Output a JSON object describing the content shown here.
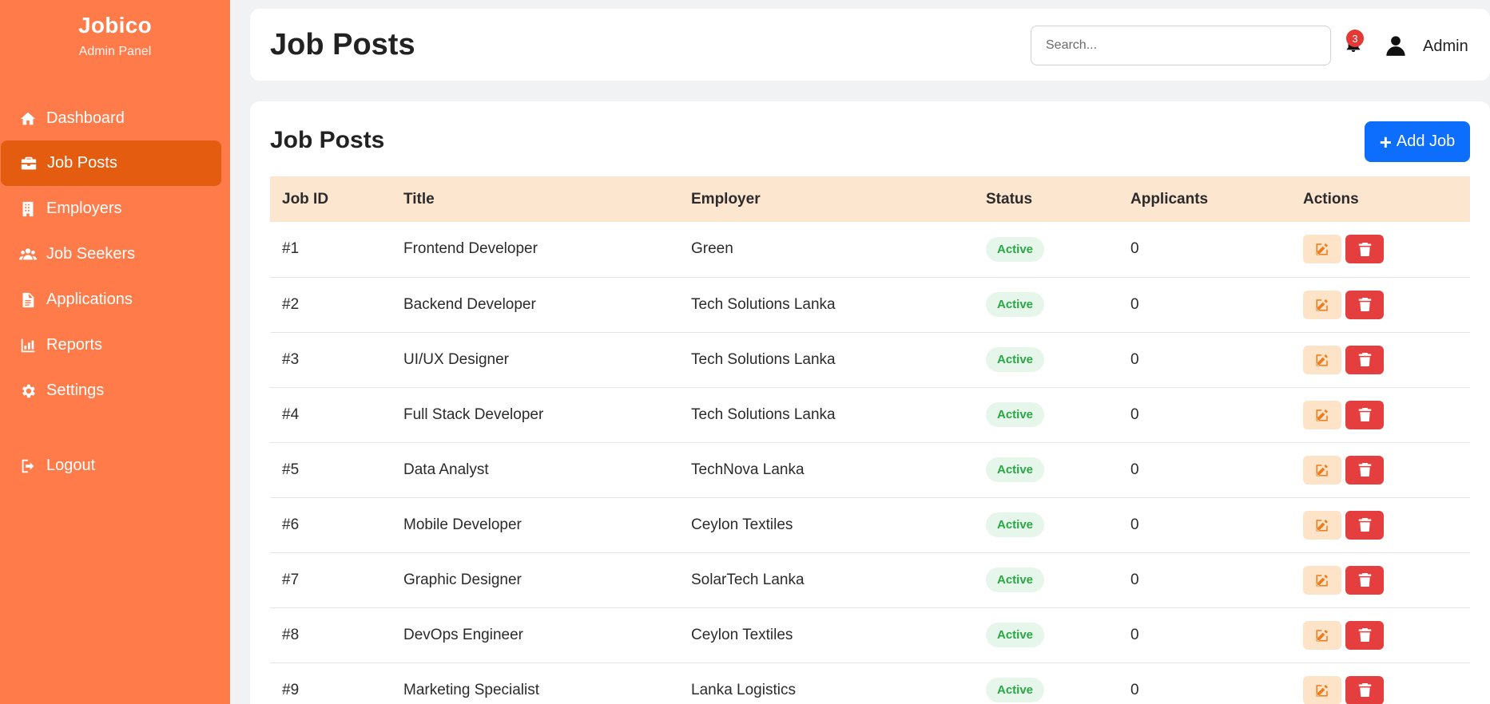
{
  "brand": {
    "name": "Jobico",
    "subtitle": "Admin Panel"
  },
  "sidebar": {
    "items": [
      {
        "label": "Dashboard",
        "icon": "home-icon",
        "active": false
      },
      {
        "label": "Job Posts",
        "icon": "briefcase-icon",
        "active": true
      },
      {
        "label": "Employers",
        "icon": "building-icon",
        "active": false
      },
      {
        "label": "Job Seekers",
        "icon": "users-icon",
        "active": false
      },
      {
        "label": "Applications",
        "icon": "file-icon",
        "active": false
      },
      {
        "label": "Reports",
        "icon": "chart-icon",
        "active": false
      },
      {
        "label": "Settings",
        "icon": "gear-icon",
        "active": false
      },
      {
        "label": "Logout",
        "icon": "logout-icon",
        "active": false
      }
    ]
  },
  "header": {
    "title": "Job Posts",
    "search_placeholder": "Search...",
    "notification_count": "3",
    "user_name": "Admin"
  },
  "main": {
    "card_title": "Job Posts",
    "add_button_label": "Add Job",
    "columns": [
      "Job ID",
      "Title",
      "Employer",
      "Status",
      "Applicants",
      "Actions"
    ],
    "rows": [
      {
        "id": "#1",
        "title": "Frontend Developer",
        "employer": "Green",
        "status": "Active",
        "applicants": "0"
      },
      {
        "id": "#2",
        "title": "Backend Developer",
        "employer": "Tech Solutions Lanka",
        "status": "Active",
        "applicants": "0"
      },
      {
        "id": "#3",
        "title": "UI/UX Designer",
        "employer": "Tech Solutions Lanka",
        "status": "Active",
        "applicants": "0"
      },
      {
        "id": "#4",
        "title": "Full Stack Developer",
        "employer": "Tech Solutions Lanka",
        "status": "Active",
        "applicants": "0"
      },
      {
        "id": "#5",
        "title": "Data Analyst",
        "employer": "TechNova Lanka",
        "status": "Active",
        "applicants": "0"
      },
      {
        "id": "#6",
        "title": "Mobile Developer",
        "employer": "Ceylon Textiles",
        "status": "Active",
        "applicants": "0"
      },
      {
        "id": "#7",
        "title": "Graphic Designer",
        "employer": "SolarTech Lanka",
        "status": "Active",
        "applicants": "0"
      },
      {
        "id": "#8",
        "title": "DevOps Engineer",
        "employer": "Ceylon Textiles",
        "status": "Active",
        "applicants": "0"
      },
      {
        "id": "#9",
        "title": "Marketing Specialist",
        "employer": "Lanka Logistics",
        "status": "Active",
        "applicants": "0"
      }
    ]
  },
  "colors": {
    "sidebar_bg": "#ff7b4a",
    "sidebar_active": "#e35c10",
    "primary_button": "#0d6efd",
    "table_header_bg": "#fde6d0",
    "status_active_text": "#28a745",
    "status_active_bg": "#e6f6ea",
    "edit_button_bg": "#fde3c8",
    "delete_button_bg": "#e53e3e"
  }
}
